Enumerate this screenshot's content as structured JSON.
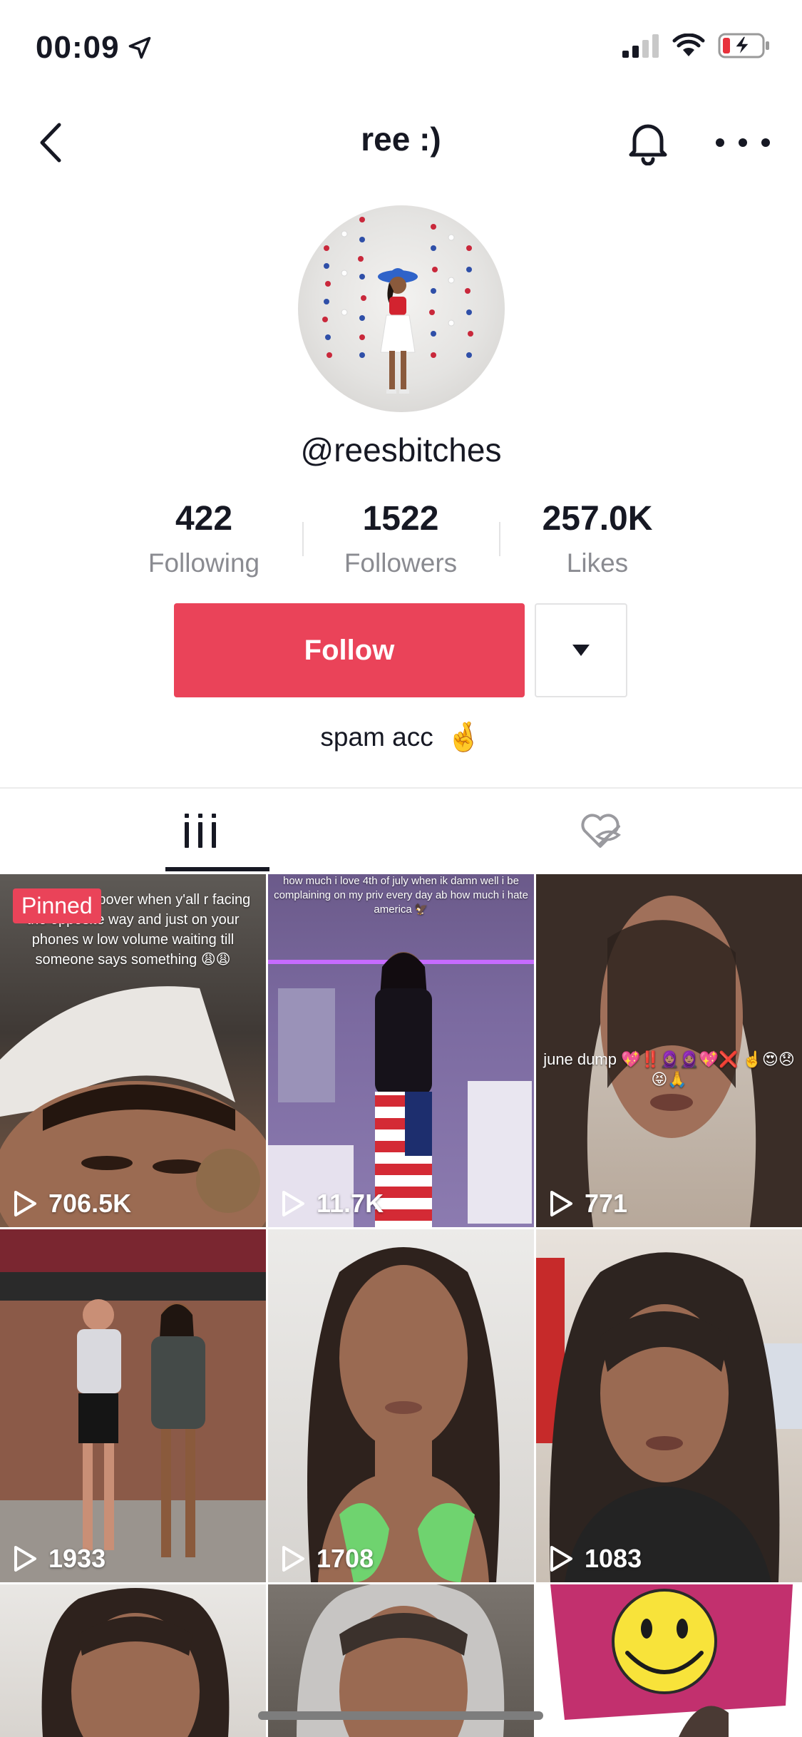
{
  "status_bar": {
    "time": "00:09"
  },
  "nav": {
    "title": "ree :)"
  },
  "profile": {
    "username": "@reesbitches",
    "bio": "spam acc",
    "bio_emoji": "🤞"
  },
  "stats": [
    {
      "value": "422",
      "label": "Following"
    },
    {
      "value": "1522",
      "label": "Followers"
    },
    {
      "value": "257.0K",
      "label": "Likes"
    }
  ],
  "actions": {
    "follow_label": "Follow"
  },
  "videos": [
    {
      "count": "706.5K",
      "pinned_label": "Pinned",
      "caption": "after the sleepover when y'all r facing the opposite way and just on your phones w low volume waiting till someone says something 😩😩"
    },
    {
      "count": "11.7K",
      "caption": "how much i love 4th of july when ik damn well i be complaining on my priv every day ab how much i hate america 🦅"
    },
    {
      "count": "771",
      "caption": "june dump 💖‼️🧕🏽🧕🏽💖❌ ☝️😍😞😝🙏"
    },
    {
      "count": "1933"
    },
    {
      "count": "1708"
    },
    {
      "count": "1083"
    },
    {},
    {},
    {}
  ],
  "colors": {
    "accent": "#ea4359",
    "text": "#161823",
    "muted": "#8a8b91"
  }
}
